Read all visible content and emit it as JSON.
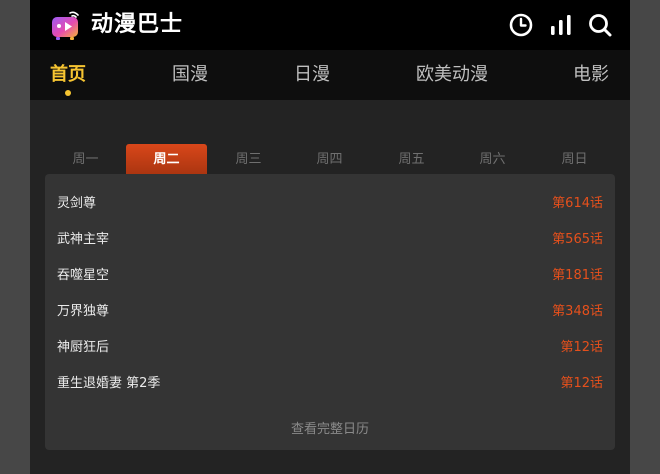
{
  "header": {
    "brand": "动漫巴士",
    "icons": [
      "history-clock-icon",
      "ranking-bars-icon",
      "search-icon"
    ]
  },
  "nav": {
    "items": [
      {
        "label": "首页",
        "active": true
      },
      {
        "label": "国漫",
        "active": false
      },
      {
        "label": "日漫",
        "active": false
      },
      {
        "label": "欧美动漫",
        "active": false
      },
      {
        "label": "电影",
        "active": false
      }
    ]
  },
  "schedule": {
    "days": [
      "周一",
      "周二",
      "周三",
      "周四",
      "周五",
      "周六",
      "周日"
    ],
    "active_day": "周二",
    "items": [
      {
        "title": "灵剑尊",
        "episode": "第614话"
      },
      {
        "title": "武神主宰",
        "episode": "第565话"
      },
      {
        "title": "吞噬星空",
        "episode": "第181话"
      },
      {
        "title": "万界独尊",
        "episode": "第348话"
      },
      {
        "title": "神厨狂后",
        "episode": "第12话"
      },
      {
        "title": "重生退婚妻 第2季",
        "episode": "第12话"
      }
    ],
    "more_label": "查看完整日历"
  },
  "colors": {
    "accent_yellow": "#f6c431",
    "accent_orange": "#e5501c",
    "header_bg": "#000000",
    "page_bg": "#232323"
  }
}
